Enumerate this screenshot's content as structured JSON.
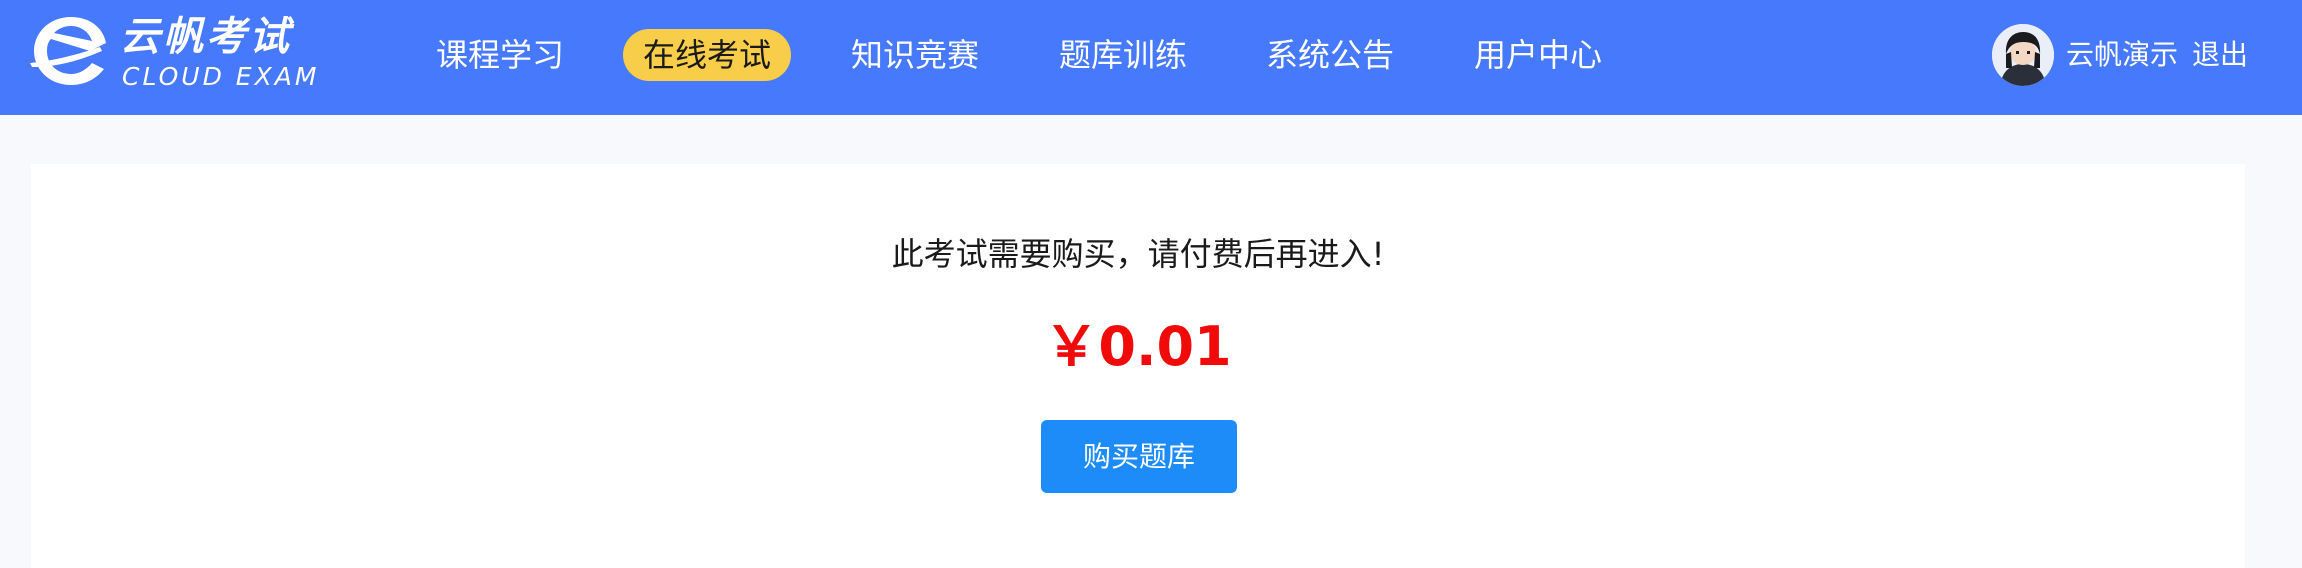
{
  "header": {
    "logo": {
      "title_cn": "云帆考试",
      "title_en": "CLOUD EXAM"
    },
    "nav": [
      {
        "label": "课程学习",
        "active": false
      },
      {
        "label": "在线考试",
        "active": true
      },
      {
        "label": "知识竞赛",
        "active": false
      },
      {
        "label": "题库训练",
        "active": false
      },
      {
        "label": "系统公告",
        "active": false
      },
      {
        "label": "用户中心",
        "active": false
      }
    ],
    "user": {
      "name": "云帆演示",
      "logout_label": "退出"
    }
  },
  "main": {
    "notice": "此考试需要购买，请付费后再进入!",
    "price": "￥0.01",
    "buy_button": "购买题库"
  },
  "colors": {
    "header_bg": "#4679fb",
    "nav_active_bg": "#f8cd49",
    "price": "#f00a0a",
    "button": "#1d8cf8",
    "page_bg": "#f7f9fd"
  }
}
